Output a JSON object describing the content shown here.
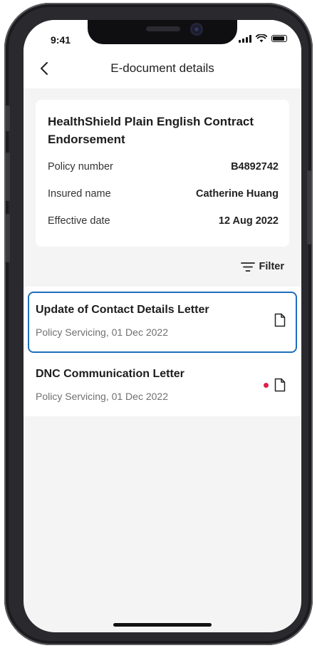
{
  "status_bar": {
    "time": "9:41"
  },
  "header": {
    "title": "E-document details",
    "back_icon": "chevron-left-icon"
  },
  "summary": {
    "title": "HealthShield Plain English Contract Endorsement",
    "rows": [
      {
        "label": "Policy number",
        "value": "B4892742"
      },
      {
        "label": "Insured name",
        "value": "Catherine Huang"
      },
      {
        "label": "Effective date",
        "value": "12 Aug 2022"
      }
    ]
  },
  "filter": {
    "label": "Filter",
    "icon": "filter-icon"
  },
  "documents": [
    {
      "title": "Update of Contact Details Letter",
      "subtitle": "Policy Servicing, 01 Dec 2022",
      "selected": true,
      "unread": false,
      "icon": "document-icon"
    },
    {
      "title": "DNC Communication Letter",
      "subtitle": "Policy Servicing, 01 Dec 2022",
      "selected": false,
      "unread": true,
      "icon": "document-icon"
    }
  ],
  "colors": {
    "selection_border": "#1f6fbd",
    "unread_dot": "#e21d4a",
    "background": "#f4f4f4"
  }
}
